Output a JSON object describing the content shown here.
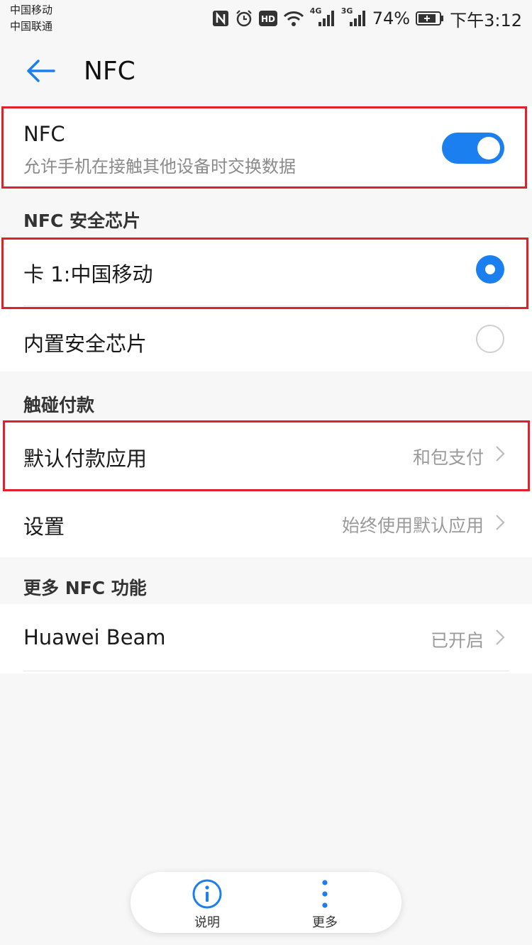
{
  "status_bar": {
    "carrier1": "中国移动",
    "carrier2": "中国联通",
    "network1": "4G",
    "network2": "3G",
    "battery": "74%",
    "time": "下午3:12"
  },
  "header": {
    "title": "NFC"
  },
  "nfc": {
    "title": "NFC",
    "subtitle": "允许手机在接触其他设备时交换数据",
    "enabled": true
  },
  "secure_chip": {
    "header": "NFC 安全芯片",
    "options": [
      {
        "label": "卡 1:中国移动",
        "selected": true
      },
      {
        "label": "内置安全芯片",
        "selected": false
      }
    ]
  },
  "payment": {
    "header": "触碰付款",
    "items": [
      {
        "label": "默认付款应用",
        "value": "和包支付"
      },
      {
        "label": "设置",
        "value": "始终使用默认应用"
      }
    ]
  },
  "more": {
    "header": "更多 NFC 功能",
    "items": [
      {
        "label": "Huawei Beam",
        "value": "已开启"
      }
    ]
  },
  "bottom_bar": {
    "info_label": "说明",
    "more_label": "更多"
  },
  "colors": {
    "accent": "#1c7fef",
    "highlight": "#e0202a"
  },
  "icons": [
    "nfc-icon",
    "alarm-icon",
    "hd-icon",
    "wifi-icon",
    "signal-icon",
    "battery-icon",
    "back-arrow-icon",
    "chevron-right-icon",
    "info-icon",
    "more-vertical-icon"
  ]
}
